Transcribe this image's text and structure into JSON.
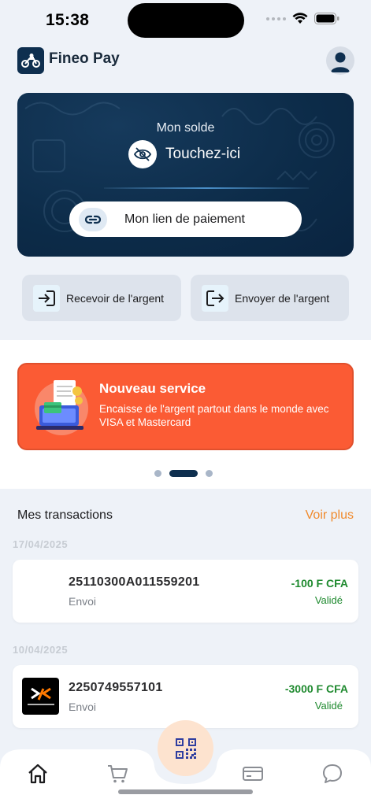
{
  "status_bar": {
    "time": "15:38"
  },
  "header": {
    "app_name": "Fineo Pay"
  },
  "balance_card": {
    "label": "Mon solde",
    "tap_text": "Touchez-ici",
    "payment_link_label": "Mon lien de paiement"
  },
  "actions": {
    "receive_label": "Recevoir de l'argent",
    "send_label": "Envoyer de l'argent"
  },
  "promo": {
    "title": "Nouveau service",
    "text": "Encaisse de l'argent partout dans le monde avec VISA et Mastercard",
    "pager": {
      "count": 3,
      "active_index": 1
    }
  },
  "transactions": {
    "title": "Mes transactions",
    "see_more": "Voir plus",
    "groups": [
      {
        "date": "17/04/2025",
        "items": [
          {
            "id": "25110300A011559201",
            "type": "Envoi",
            "amount": "-100 F CFA",
            "status": "Validé",
            "logo": ""
          }
        ]
      },
      {
        "date": "10/04/2025",
        "items": [
          {
            "id": "2250749557101",
            "type": "Envoi",
            "amount": "-3000 F CFA",
            "status": "Validé",
            "logo": "orange-money-logo"
          }
        ]
      }
    ]
  },
  "bottom_nav": {
    "items": [
      "home-icon",
      "cart-icon",
      "qr-code-icon",
      "card-icon",
      "chat-icon"
    ]
  },
  "colors": {
    "navy": "#0e2f4f",
    "orange_promo": "#fb5b34",
    "accent_orange": "#f08a2c",
    "success_green": "#1f8a2f",
    "page_bg": "#eef2f8"
  }
}
